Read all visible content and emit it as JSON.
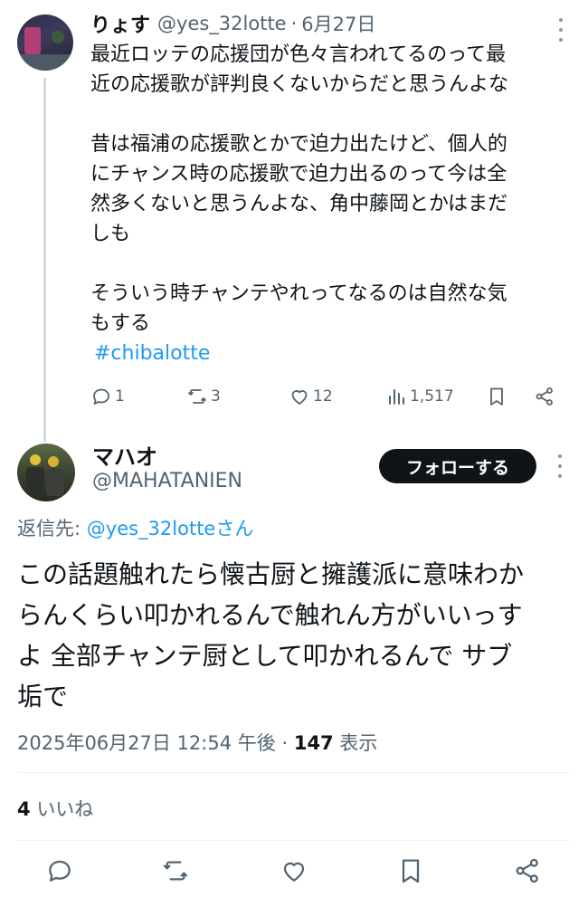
{
  "parent": {
    "name": "りょす",
    "handle": "@yes_32lotte",
    "separator": "·",
    "date": "6月27日",
    "lines": [
      "最近ロッテの応援団が色々言われてるのって最",
      "近の応援歌が評判良くないからだと思うんよな",
      "",
      "昔は福浦の応援歌とかで迫力出たけど、個人的",
      "にチャンス時の応援歌で迫力出るのって今は全",
      "然多くないと思うんよな、角中藤岡とかはまだ",
      "しも",
      "",
      "そういう時チャンテやれってなるのは自然な気",
      "もする"
    ],
    "hashtag": "#chibalotte",
    "stats": {
      "replies": "1",
      "retweets": "3",
      "likes": "12",
      "views": "1,517"
    }
  },
  "reply": {
    "name": "マハオ",
    "handle": "@MAHATANIEN",
    "follow_label": "フォローする",
    "reply_to_prefix": "返信先: ",
    "reply_to_mention": "@yes_32lotteさん",
    "lines": [
      "この話題触れたら懐古厨と擁護派に意味わか",
      "らんくらい叩かれるんで触れん方がいいっす",
      "よ 全部チャンテ厨として叩かれるんで サブ",
      "垢で"
    ],
    "timestamp": "2025年06月27日 12:54 午後",
    "separator": "·",
    "views_count": "147",
    "views_label": "表示",
    "likes_count": "4",
    "likes_label": "いいね"
  },
  "icons": {
    "reply": "reply-icon",
    "retweet": "retweet-icon",
    "like": "heart-icon",
    "views": "views-icon",
    "bookmark": "bookmark-icon",
    "share": "share-icon",
    "more": "more-icon"
  },
  "colors": {
    "text": "#0f1419",
    "secondary": "#536471",
    "link": "#1d9bf0",
    "thread_line": "#cfd9de"
  }
}
